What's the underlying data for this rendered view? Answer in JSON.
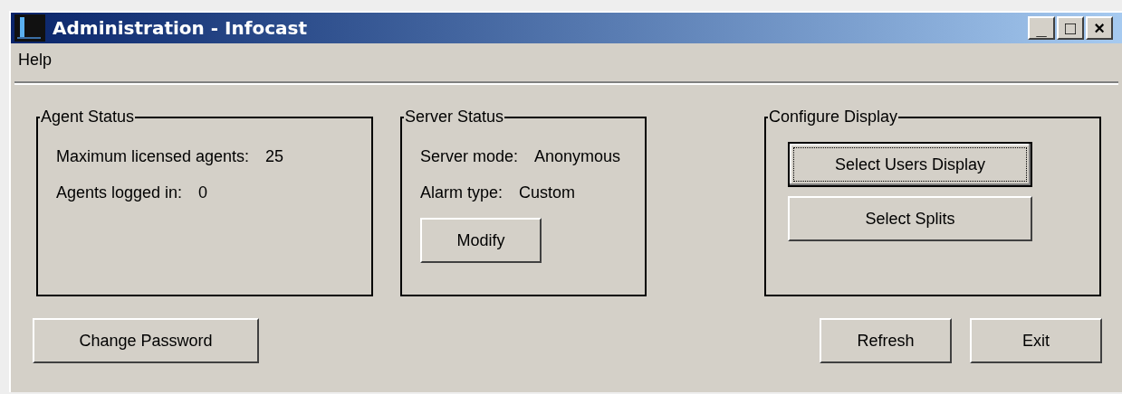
{
  "window": {
    "title": "Administration - Infocast",
    "controls": [
      "_",
      "□",
      "×"
    ]
  },
  "menu": [
    {
      "label": "Help"
    }
  ],
  "groups": [
    {
      "title": "Agent Status",
      "fields": [
        {
          "label": "Maximum licensed agents:",
          "value": "25"
        },
        {
          "label": "Agents logged in:",
          "value": "0"
        }
      ]
    },
    {
      "title": "Server Status",
      "fields": [
        {
          "label": "Server mode:",
          "value": "Anonymous"
        },
        {
          "label": "Alarm type:",
          "value": "Custom"
        }
      ],
      "buttons": [
        {
          "label": "Modify",
          "focused": false
        }
      ]
    },
    {
      "title": "Configure Display",
      "buttons": [
        {
          "label": "Select Users Display",
          "focused": true
        },
        {
          "label": "Select Splits",
          "focused": false
        }
      ]
    }
  ],
  "bottom_buttons": [
    {
      "label": "Change Password",
      "focused": false
    },
    {
      "label": "Refresh",
      "focused": false
    },
    {
      "label": "Exit",
      "focused": false
    }
  ]
}
